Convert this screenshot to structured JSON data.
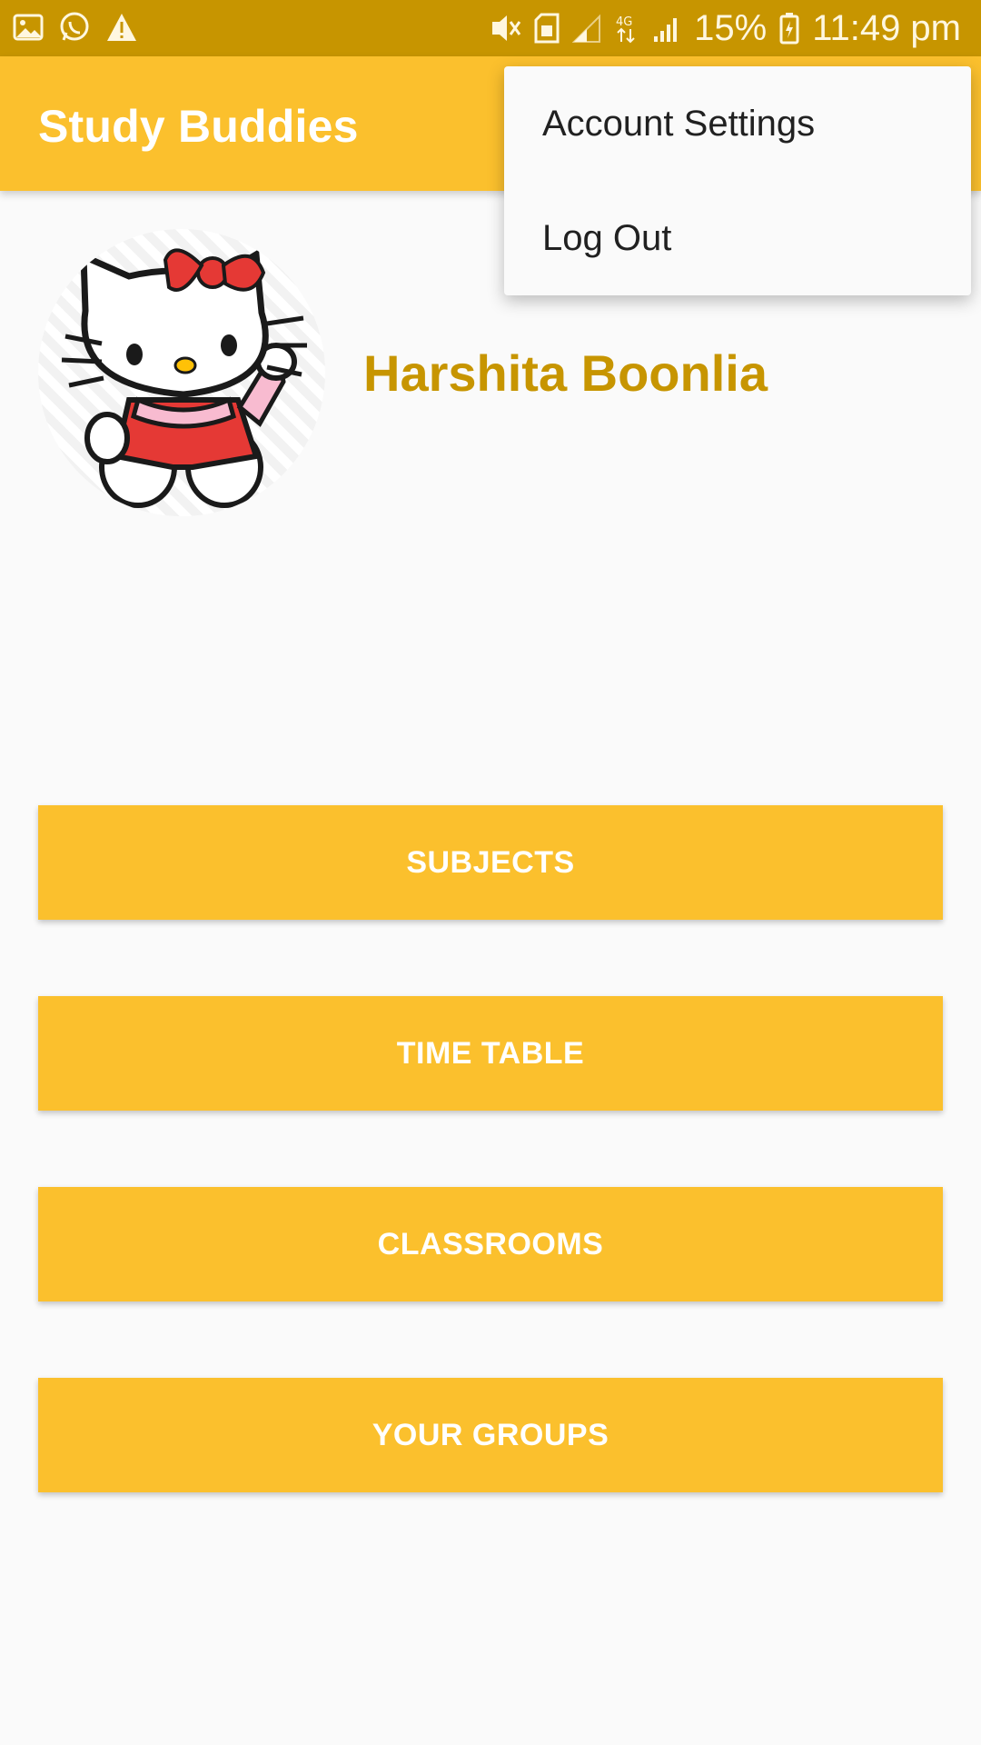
{
  "status_bar": {
    "battery": "15%",
    "time": "11:49 pm",
    "icons": [
      "image-icon",
      "whatsapp-icon",
      "warning-icon",
      "vibrate-icon",
      "sim-icon",
      "signal-icon",
      "signal-4g-icon",
      "signal-icon",
      "battery-icon"
    ]
  },
  "app_bar": {
    "title": "Study Buddies"
  },
  "profile": {
    "name": "Harshita Boonlia"
  },
  "buttons": {
    "subjects": "SUBJECTS",
    "time_table": "TIME TABLE",
    "classrooms": "CLASSROOMS",
    "your_groups": "YOUR GROUPS"
  },
  "overflow_menu": {
    "items": [
      {
        "label": "Account Settings"
      },
      {
        "label": "Log Out"
      }
    ]
  },
  "colors": {
    "accent": "#FBC02D",
    "status_bar": "#C79500",
    "name_text": "#C79500"
  }
}
